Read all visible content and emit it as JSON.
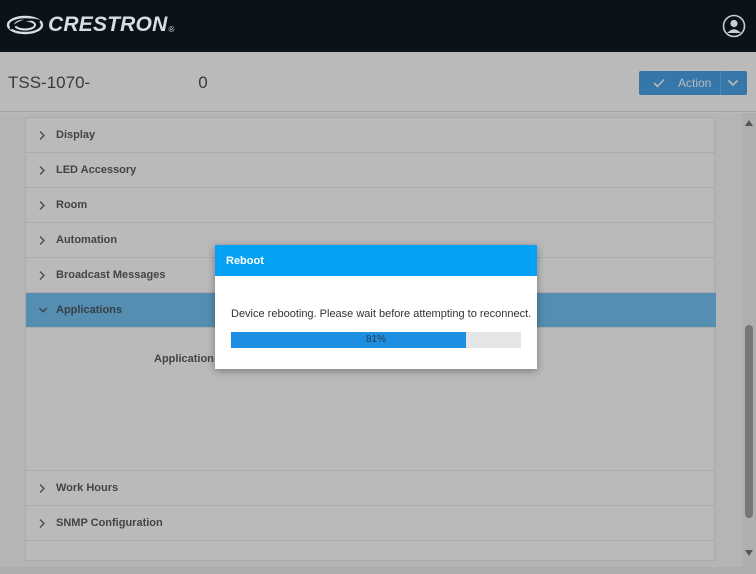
{
  "brand": {
    "name": "CRESTRON",
    "registered": "®"
  },
  "header": {
    "device_prefix": "TSS-1070-",
    "device_suffix": "0",
    "action_label": "Action"
  },
  "settings": {
    "rows": [
      {
        "label": "Display",
        "expanded": false
      },
      {
        "label": "LED Accessory",
        "expanded": false
      },
      {
        "label": "Room",
        "expanded": false
      },
      {
        "label": "Automation",
        "expanded": false
      },
      {
        "label": "Broadcast Messages",
        "expanded": false
      },
      {
        "label": "Applications",
        "expanded": true
      },
      {
        "label": "Work Hours",
        "expanded": false
      },
      {
        "label": "SNMP Configuration",
        "expanded": false
      }
    ],
    "applications_field_label": "Application M"
  },
  "modal": {
    "title": "Reboot",
    "message": "Device rebooting. Please wait before attempting to reconnect.",
    "progress": 81,
    "progress_label": "81%"
  },
  "colors": {
    "topbar": "#0b1219",
    "accent": "#1b8ce0",
    "modal_header": "#05a1f2",
    "active_row": "#52b3ee"
  }
}
